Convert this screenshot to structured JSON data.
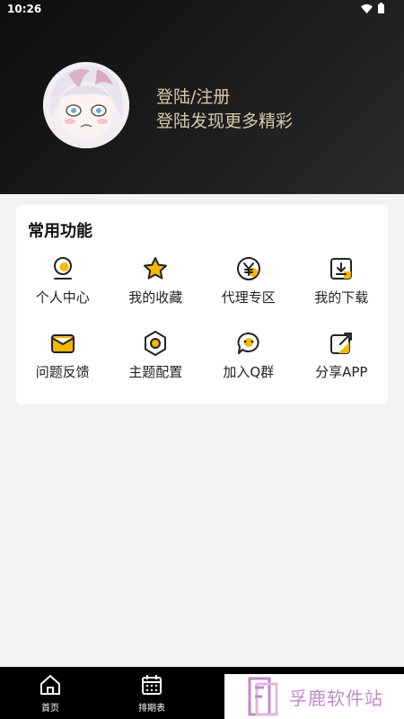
{
  "status_bar": {
    "time": "10:26",
    "wifi_icon": "wifi-icon",
    "battery_icon": "battery-icon"
  },
  "profile": {
    "avatar_icon": "anime-avatar",
    "login_title": "登陆/注册",
    "login_subtitle": "登陆发现更多精彩"
  },
  "functions": {
    "title": "常用功能",
    "items": [
      {
        "label": "个人中心",
        "icon": "person-icon"
      },
      {
        "label": "我的收藏",
        "icon": "star-icon"
      },
      {
        "label": "代理专区",
        "icon": "yen-icon"
      },
      {
        "label": "我的下载",
        "icon": "download-icon"
      },
      {
        "label": "问题反馈",
        "icon": "mail-icon"
      },
      {
        "label": "主题配置",
        "icon": "hexagon-icon"
      },
      {
        "label": "加入Q群",
        "icon": "chat-icon"
      },
      {
        "label": "分享APP",
        "icon": "share-icon"
      }
    ]
  },
  "bottom_nav": {
    "items": [
      {
        "label": "首页",
        "icon": "home-icon"
      },
      {
        "label": "排期表",
        "icon": "calendar-icon"
      }
    ]
  },
  "watermark": {
    "text": "孚鹿软件站"
  },
  "colors": {
    "accent": "#f5b800",
    "login_text": "#d6c8aa",
    "header_bg": "#151515"
  }
}
